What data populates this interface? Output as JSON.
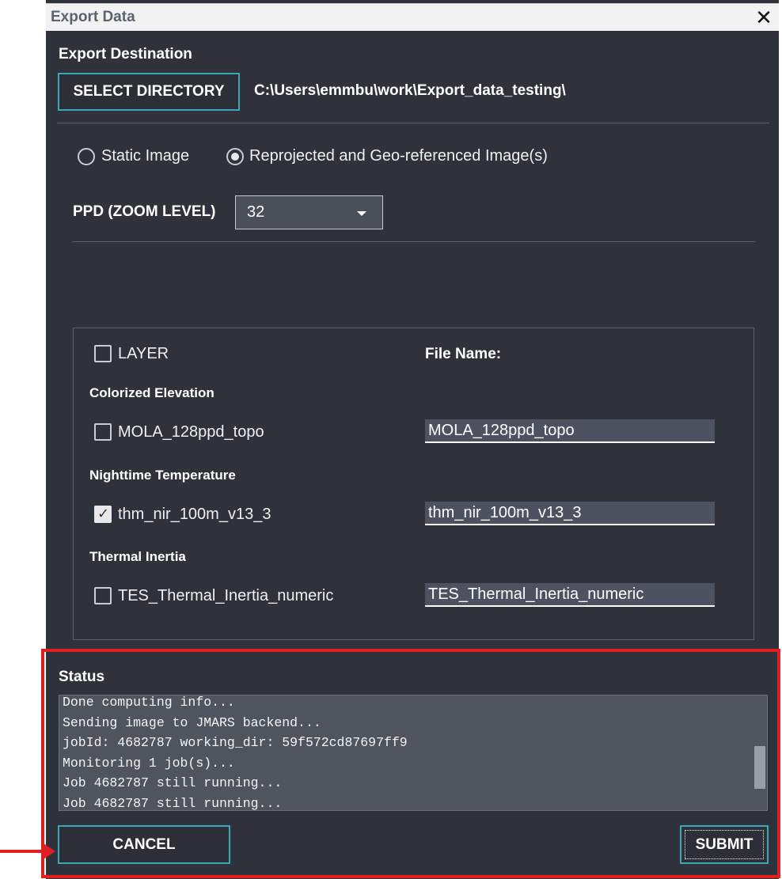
{
  "window": {
    "title": "Export Data"
  },
  "destination": {
    "heading": "Export Destination",
    "select_label": "SELECT DIRECTORY",
    "path": "C:\\Users\\emmbu\\work\\Export_data_testing\\"
  },
  "export_type": {
    "options": [
      {
        "label": "Static Image",
        "selected": false
      },
      {
        "label": "Reprojected and Geo-referenced Image(s)",
        "selected": true
      }
    ]
  },
  "ppd": {
    "label": "PPD (ZOOM LEVEL)",
    "value": "32"
  },
  "layers": {
    "header_label": "LAYER",
    "filename_header": "File Name:",
    "groups": [
      {
        "title": "Colorized Elevation",
        "layer": "MOLA_128ppd_topo",
        "filename": "MOLA_128ppd_topo",
        "checked": false
      },
      {
        "title": "Nighttime Temperature",
        "layer": "thm_nir_100m_v13_3",
        "filename": "thm_nir_100m_v13_3",
        "checked": true
      },
      {
        "title": "Thermal Inertia",
        "layer": "TES_Thermal_Inertia_numeric",
        "filename": "TES_Thermal_Inertia_numeric",
        "checked": false
      }
    ]
  },
  "status": {
    "heading": "Status",
    "log": [
      "Done computing info...",
      "Sending image to JMARS backend...",
      "jobId: 4682787 working_dir: 59f572cd87697ff9",
      "Monitoring 1 job(s)...",
      "Job 4682787 still running...",
      "Job 4682787 still running..."
    ]
  },
  "actions": {
    "cancel_label": "CANCEL",
    "submit_label": "SUBMIT"
  },
  "colors": {
    "accent": "#3aa7b7",
    "background": "#2f323a",
    "highlight": "#e02020"
  }
}
